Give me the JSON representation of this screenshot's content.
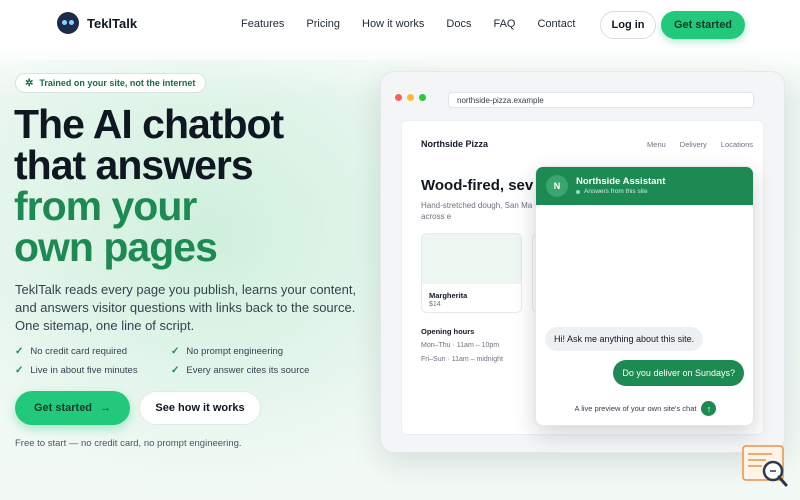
{
  "brand": {
    "name": "TeklTalk"
  },
  "nav": {
    "links": [
      "Features",
      "Pricing",
      "How it works",
      "Docs",
      "FAQ",
      "Contact"
    ],
    "login": "Log in",
    "get_started": "Get started"
  },
  "hero": {
    "badge": "Trained on your site, not the internet",
    "headline_1": "The AI chatbot",
    "headline_2": "that answers",
    "headline_3": "from your",
    "headline_4": "own pages",
    "subtitle": "TeklTalk reads every page you publish, learns your content, and answers visitor questions with links back to the source. One sitemap, one line of script.",
    "checks": [
      "No credit card required",
      "No prompt engineering",
      "Live in about five minutes",
      "Every answer cites its source"
    ],
    "cta_primary": "Get started",
    "cta_secondary": "See how it works",
    "footnote": "Free to start — no credit card, no prompt engineering."
  },
  "mock": {
    "url": "northside-pizza.example",
    "site_name": "Northside Pizza",
    "site_nav": [
      "Menu",
      "Delivery",
      "Locations"
    ],
    "headline": "Wood-fired, sev",
    "text": "Hand-stretched dough, San Ma second bake. Delivery across e",
    "card_name": "Margherita",
    "card_price": "$14",
    "hours_title": "Opening hours",
    "hours_1": "Mon–Thu · 11am – 10pm",
    "hours_2": "Fri–Sun · 11am – midnight"
  },
  "chat": {
    "avatar": "N",
    "title": "Northside Assistant",
    "subtitle": "Answers from this site",
    "bot_message": "Hi! Ask me anything about this site.",
    "user_message": "Do you deliver on Sundays?",
    "preview_note": "A live preview of your own site's chat"
  },
  "colors": {
    "accent": "#22c97c",
    "brand_green": "#1c8a52",
    "mac_red": "#ff5f57",
    "mac_yellow": "#febc2e",
    "mac_green": "#28c840"
  }
}
